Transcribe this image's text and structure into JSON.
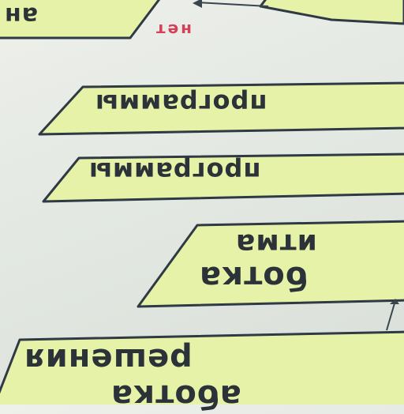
{
  "colors": {
    "fill": "#e6f2a8",
    "stroke": "#2f3a44",
    "text": "#2b3238",
    "edge_label": "#d2405a"
  },
  "blocks": [
    {
      "id": "top-left",
      "lines": [
        "ан"
      ]
    },
    {
      "id": "program-1",
      "lines": [
        "программы"
      ]
    },
    {
      "id": "program-2",
      "lines": [
        "программы"
      ]
    },
    {
      "id": "processing",
      "lines": [
        "ботка",
        "итма"
      ]
    },
    {
      "id": "solution",
      "lines": [
        "аботка",
        "решения"
      ]
    }
  ],
  "edge_label": "нет"
}
